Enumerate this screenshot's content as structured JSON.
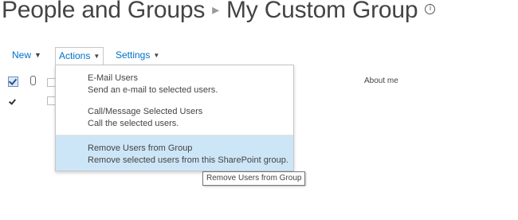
{
  "header": {
    "breadcrumb_root": "People and Groups",
    "separator": "▸",
    "page_title": "My Custom Group",
    "info_icon": "info-circle-icon"
  },
  "toolbar": {
    "new_label": "New",
    "actions_label": "Actions",
    "settings_label": "Settings",
    "dropdown_icon": "chevron-down-icon"
  },
  "list": {
    "column_about": "About me"
  },
  "actions_menu": {
    "items": [
      {
        "title": "E-Mail Users",
        "description": "Send an e-mail to selected users."
      },
      {
        "title": "Call/Message Selected Users",
        "description": "Call the selected users."
      },
      {
        "title": "Remove Users from Group",
        "description": "Remove selected users from this SharePoint group.",
        "highlighted": true
      }
    ]
  },
  "tooltip": {
    "text": "Remove Users from Group"
  },
  "colors": {
    "link": "#0072c6",
    "highlight": "#cde6f7",
    "text": "#444444"
  }
}
